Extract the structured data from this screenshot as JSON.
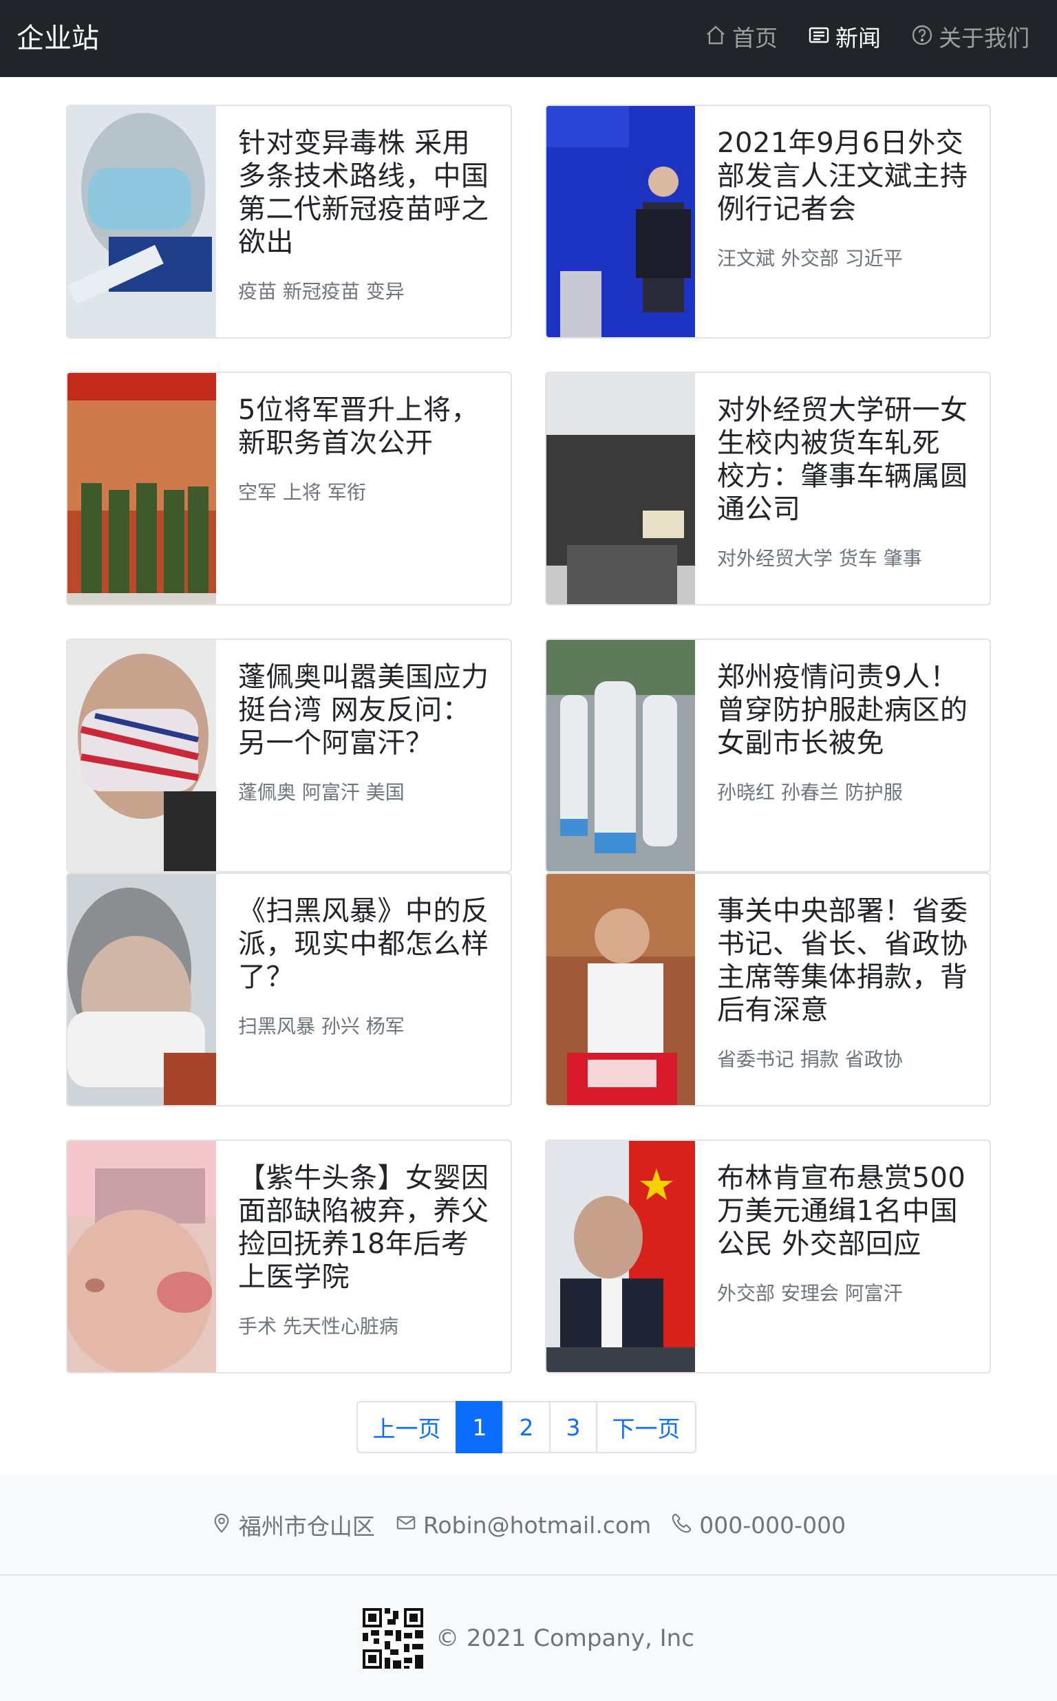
{
  "navbar": {
    "brand": "企业站",
    "items": [
      {
        "label": "首页",
        "icon": "house-icon",
        "active": false
      },
      {
        "label": "新闻",
        "icon": "newspaper-icon",
        "active": true
      },
      {
        "label": "关于我们",
        "icon": "question-circle-icon",
        "active": false
      }
    ]
  },
  "news": [
    {
      "title": "针对变异毒株 采用多条技术路线，中国第二代新冠疫苗呼之欲出",
      "tags": "疫苗 新冠疫苗 变异"
    },
    {
      "title": "2021年9月6日外交部发言人汪文斌主持例行记者会",
      "tags": "汪文斌 外交部 习近平"
    },
    {
      "title": "5位将军晋升上将，新职务首次公开",
      "tags": "空军 上将 军衔"
    },
    {
      "title": "对外经贸大学研一女生校内被货车轧死 校方：肇事车辆属圆通公司",
      "tags": "对外经贸大学 货车 肇事"
    },
    {
      "title": "蓬佩奥叫嚣美国应力挺台湾 网友反问：另一个阿富汗？",
      "tags": "蓬佩奥 阿富汗 美国"
    },
    {
      "title": "郑州疫情问责9人！曾穿防护服赴病区的女副市长被免",
      "tags": "孙晓红 孙春兰 防护服"
    },
    {
      "title": "《扫黑风暴》中的反派，现实中都怎么样了？",
      "tags": "扫黑风暴 孙兴 杨军"
    },
    {
      "title": "事关中央部署！省委书记、省长、省政协主席等集体捐款，背后有深意",
      "tags": "省委书记 捐款 省政协"
    },
    {
      "title": "【紫牛头条】女婴因面部缺陷被弃，养父捡回抚养18年后考上医学院",
      "tags": "手术 先天性心脏病"
    },
    {
      "title": "布林肯宣布悬赏500万美元通缉1名中国公民 外交部回应",
      "tags": "外交部 安理会 阿富汗"
    }
  ],
  "pagination": {
    "prev": "上一页",
    "pages": [
      "1",
      "2",
      "3"
    ],
    "current": "1",
    "next": "下一页"
  },
  "footer": {
    "address": "福州市仓山区",
    "email": "Robin@hotmail.com",
    "phone": "000-000-000",
    "copyright": "© 2021 Company, Inc"
  },
  "colors": {
    "navbar_bg": "#212529",
    "primary": "#0d6efd",
    "muted": "#6c757d",
    "footer_bg": "#f8f9fa"
  }
}
